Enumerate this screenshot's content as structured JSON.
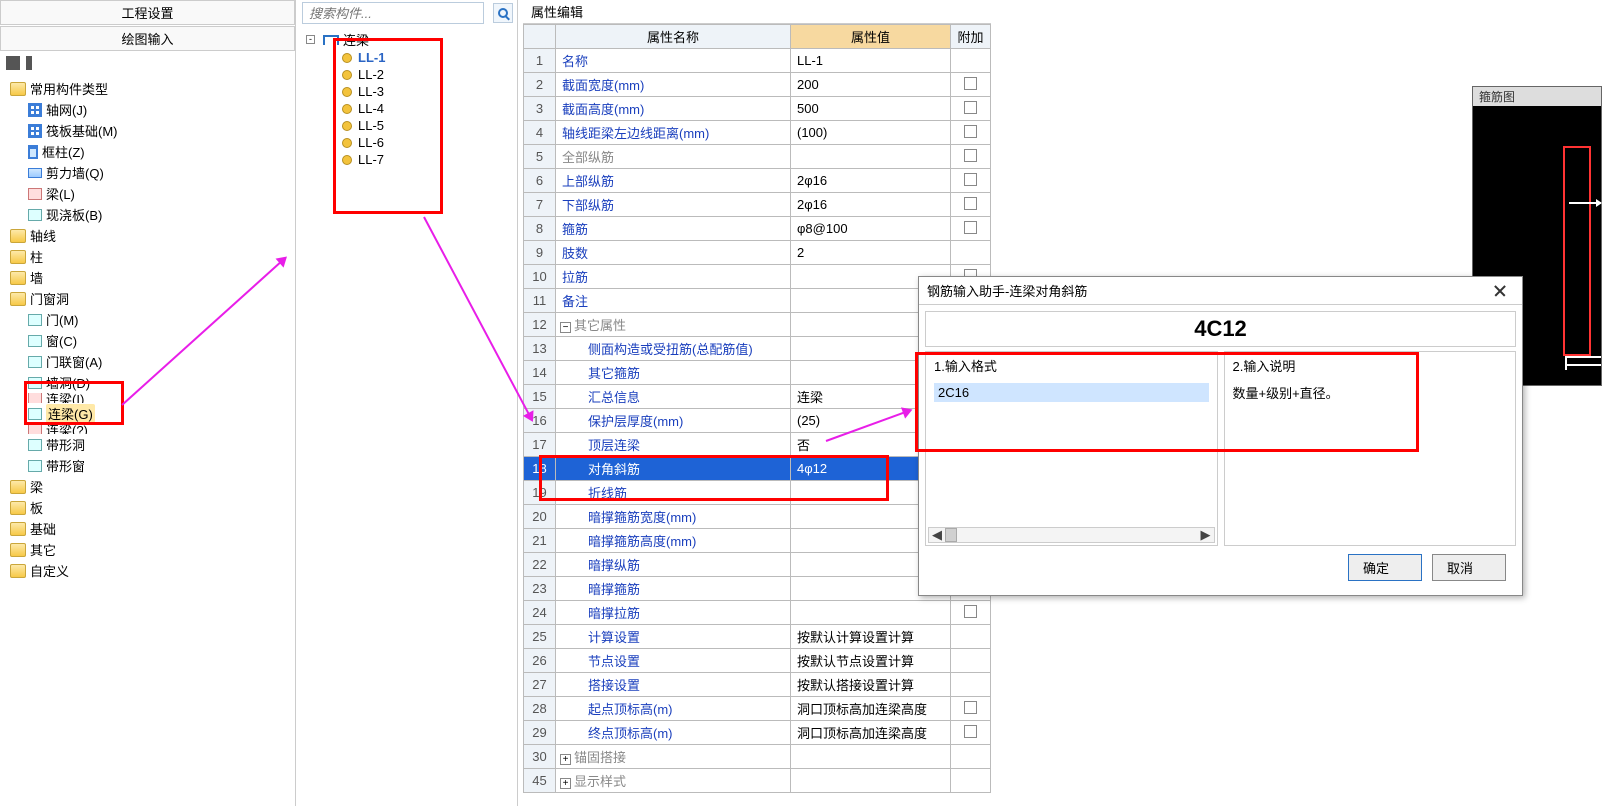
{
  "left": {
    "headers": [
      "工程设置",
      "绘图输入"
    ],
    "root": "常用构件类型",
    "categories": [
      {
        "icon": "grid-ico",
        "label": "轴网(J)"
      },
      {
        "icon": "grid-ico",
        "label": "筏板基础(M)"
      },
      {
        "icon": "col-ico",
        "label": "框柱(Z)"
      },
      {
        "icon": "wall-ico",
        "label": "剪力墙(Q)"
      },
      {
        "icon": "rect-ico",
        "label": "梁(L)"
      },
      {
        "icon": "rect-ico2",
        "label": "现浇板(B)"
      }
    ],
    "folders": [
      "轴线",
      "柱",
      "墙"
    ],
    "door_folder": "门窗洞",
    "door_items": [
      {
        "label": "门(M)"
      },
      {
        "label": "窗(C)"
      },
      {
        "label": "门联窗(A)"
      },
      {
        "label": "墙洞(D)"
      }
    ],
    "highlight_items": [
      "连梁(G)"
    ],
    "post_items": [
      "带形洞",
      "带形窗"
    ],
    "post_item_hidden": "连梁(I)",
    "bottom_folders": [
      "梁",
      "板",
      "基础",
      "其它",
      "自定义"
    ]
  },
  "components": {
    "search_placeholder": "搜索构件...",
    "root": "连梁",
    "items": [
      "LL-1",
      "LL-2",
      "LL-3",
      "LL-4",
      "LL-5",
      "LL-6",
      "LL-7"
    ],
    "selected": 0
  },
  "props": {
    "title": "属性编辑",
    "columns": [
      "属性名称",
      "属性值",
      "附加"
    ],
    "rows": [
      {
        "n": 1,
        "name": "名称",
        "val": "LL-1",
        "chk": null
      },
      {
        "n": 2,
        "name": "截面宽度(mm)",
        "val": "200",
        "chk": false
      },
      {
        "n": 3,
        "name": "截面高度(mm)",
        "val": "500",
        "chk": false
      },
      {
        "n": 4,
        "name": "轴线距梁左边线距离(mm)",
        "val": "(100)",
        "chk": false
      },
      {
        "n": 5,
        "name": "全部纵筋",
        "val": "",
        "chk": false,
        "gray": true
      },
      {
        "n": 6,
        "name": "上部纵筋",
        "val": "2φ16",
        "chk": false
      },
      {
        "n": 7,
        "name": "下部纵筋",
        "val": "2φ16",
        "chk": false
      },
      {
        "n": 8,
        "name": "箍筋",
        "val": "φ8@100",
        "chk": false
      },
      {
        "n": 9,
        "name": "肢数",
        "val": "2",
        "chk": null
      },
      {
        "n": 10,
        "name": "拉筋",
        "val": "",
        "chk": false
      },
      {
        "n": 11,
        "name": "备注",
        "val": "",
        "chk": false
      },
      {
        "n": 12,
        "name": "其它属性",
        "val": "",
        "chk": null,
        "group": true,
        "expanded": true
      },
      {
        "n": 13,
        "name": "侧面构造或受扭筋(总配筋值)",
        "val": "",
        "chk": false,
        "indent": 1
      },
      {
        "n": 14,
        "name": "其它箍筋",
        "val": "",
        "chk": null,
        "indent": 1
      },
      {
        "n": 15,
        "name": "汇总信息",
        "val": "连梁",
        "chk": false,
        "indent": 1
      },
      {
        "n": 16,
        "name": "保护层厚度(mm)",
        "val": "(25)",
        "chk": false,
        "indent": 1
      },
      {
        "n": 17,
        "name": "顶层连梁",
        "val": "否",
        "chk": false,
        "indent": 1,
        "trunc": true
      },
      {
        "n": 18,
        "name": "对角斜筋",
        "val": "4φ12",
        "chk": false,
        "indent": 1,
        "selected": true
      },
      {
        "n": 19,
        "name": "折线筋",
        "val": "",
        "chk": false,
        "indent": 1,
        "trunc2": true
      },
      {
        "n": 20,
        "name": "暗撑箍筋宽度(mm)",
        "val": "",
        "chk": false,
        "indent": 1
      },
      {
        "n": 21,
        "name": "暗撑箍筋高度(mm)",
        "val": "",
        "chk": false,
        "indent": 1
      },
      {
        "n": 22,
        "name": "暗撑纵筋",
        "val": "",
        "chk": false,
        "indent": 1
      },
      {
        "n": 23,
        "name": "暗撑箍筋",
        "val": "",
        "chk": false,
        "indent": 1
      },
      {
        "n": 24,
        "name": "暗撑拉筋",
        "val": "",
        "chk": false,
        "indent": 1
      },
      {
        "n": 25,
        "name": "计算设置",
        "val": "按默认计算设置计算",
        "chk": null,
        "indent": 1
      },
      {
        "n": 26,
        "name": "节点设置",
        "val": "按默认节点设置计算",
        "chk": null,
        "indent": 1
      },
      {
        "n": 27,
        "name": "搭接设置",
        "val": "按默认搭接设置计算",
        "chk": null,
        "indent": 1
      },
      {
        "n": 28,
        "name": "起点顶标高(m)",
        "val": "洞口顶标高加连梁高度",
        "chk": false,
        "indent": 1
      },
      {
        "n": 29,
        "name": "终点顶标高(m)",
        "val": "洞口顶标高加连梁高度",
        "chk": false,
        "indent": 1
      },
      {
        "n": 30,
        "name": "锚固搭接",
        "val": "",
        "chk": null,
        "group": true,
        "expanded": false
      },
      {
        "n": 45,
        "name": "显示样式",
        "val": "",
        "chk": null,
        "group": true,
        "expanded": false
      }
    ]
  },
  "dialog": {
    "title": "钢筋输入助手-连梁对角斜筋",
    "value": "4C12",
    "col1_head": "1.输入格式",
    "col2_head": "2.输入说明",
    "col1_item": "2C16",
    "col2_text": "数量+级别+直径。",
    "ok": "确定",
    "cancel": "取消"
  },
  "preview": {
    "title": "箍筋图"
  }
}
